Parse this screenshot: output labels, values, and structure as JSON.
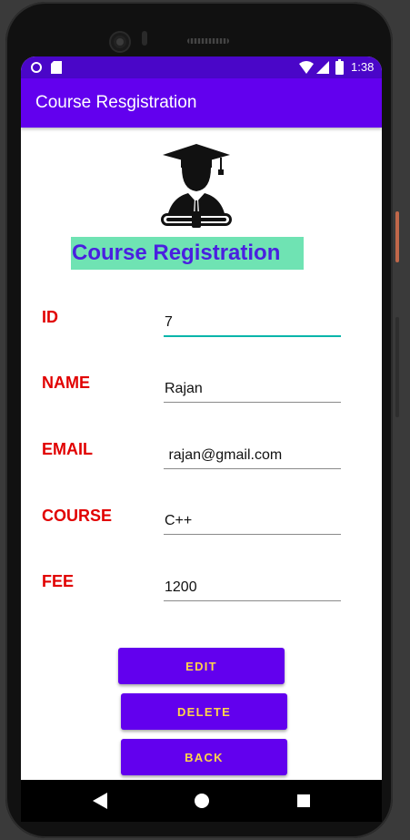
{
  "status_bar": {
    "time": "1:38"
  },
  "app_bar": {
    "title": "Course Resgistration"
  },
  "form": {
    "heading": "Course Registration",
    "fields": [
      {
        "label": "ID",
        "value": "7",
        "focused": true
      },
      {
        "label": "NAME",
        "value": "Rajan"
      },
      {
        "label": "EMAIL",
        "value": " rajan@gmail.com"
      },
      {
        "label": "COURSE",
        "value": "C++"
      },
      {
        "label": "FEE",
        "value": "1200"
      }
    ]
  },
  "buttons": {
    "edit": "EDIT",
    "delete": "DELETE",
    "back": "BACK"
  },
  "colors": {
    "primary": "#6200ee",
    "primary_dark": "#4a06c8",
    "label_red": "#e10000",
    "heading_bg": "#6fe3b3",
    "heading_text": "#4a1fe0",
    "button_text": "#ffd54a",
    "focus_accent": "#03b5aa"
  },
  "icons": [
    "graduate-logo-icon",
    "notification-dot-icon",
    "sd-card-icon",
    "wifi-icon",
    "signal-icon",
    "battery-icon",
    "nav-back-icon",
    "nav-home-icon",
    "nav-recents-icon"
  ]
}
